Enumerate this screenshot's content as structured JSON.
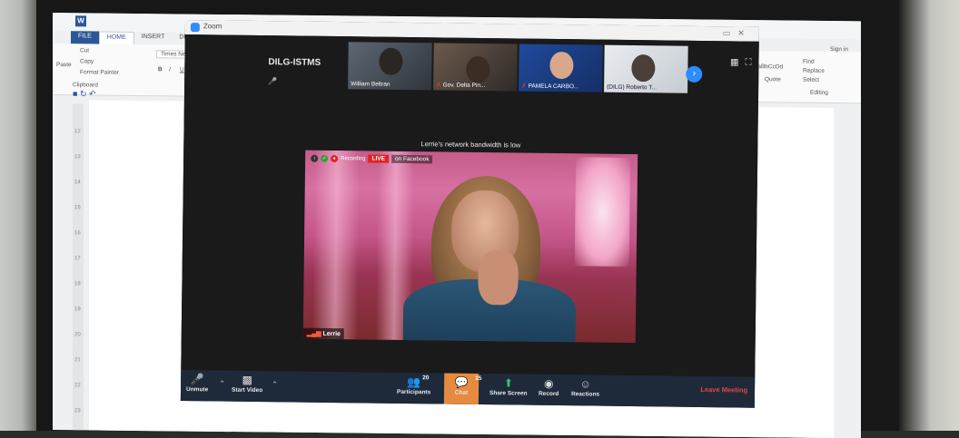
{
  "word": {
    "tabs": [
      "FILE",
      "HOME",
      "INSERT",
      "DESIGN"
    ],
    "clipboard": {
      "cut": "Cut",
      "copy": "Copy",
      "paste": "Paste",
      "format_painter": "Format Painter",
      "group": "Clipboard"
    },
    "font_name": "Times New R",
    "format_buttons": [
      "B",
      "I",
      "U"
    ],
    "styles": [
      "AaBbCcDd",
      "Quote"
    ],
    "editing": {
      "find": "Find",
      "replace": "Replace",
      "select": "Select",
      "group": "Editing"
    },
    "signin": "Sign in",
    "ruler_numbers": [
      "12",
      "13",
      "14",
      "15",
      "16",
      "17",
      "18",
      "19",
      "20",
      "21",
      "22",
      "23"
    ]
  },
  "zoom": {
    "window_title": "Zoom",
    "meeting_name": "DILG-ISTMS",
    "participants_strip": [
      {
        "name": "William Beltran",
        "muted": false
      },
      {
        "name": "Gov. Delta Pin...",
        "muted": true
      },
      {
        "name": "PAMELA CARBO...",
        "muted": true
      },
      {
        "name": "(DILG) Roberto T...",
        "muted": false
      }
    ],
    "notice": "Lerrie's network bandwidth is low",
    "active_speaker": "Lerrie",
    "recording_label": "Recording",
    "live_label": "LIVE",
    "facebook_label": "on Facebook",
    "toolbar": {
      "unmute": "Unmute",
      "start_video": "Start Video",
      "participants": "Participants",
      "participants_count": "20",
      "chat": "Chat",
      "chat_count": "15",
      "share_screen": "Share Screen",
      "record": "Record",
      "reactions": "Reactions",
      "leave": "Leave Meeting"
    }
  },
  "colors": {
    "zoom_blue": "#2d8cff",
    "live_red": "#e02424",
    "chat_orange": "#e48b3f",
    "leave_red": "#e84545",
    "word_blue": "#2b5797"
  },
  "icons": [
    "microphone-muted-icon",
    "video-off-icon",
    "participants-icon",
    "chat-icon",
    "share-screen-icon",
    "record-icon",
    "reactions-icon",
    "gallery-view-icon",
    "fullscreen-icon",
    "next-page-icon"
  ]
}
